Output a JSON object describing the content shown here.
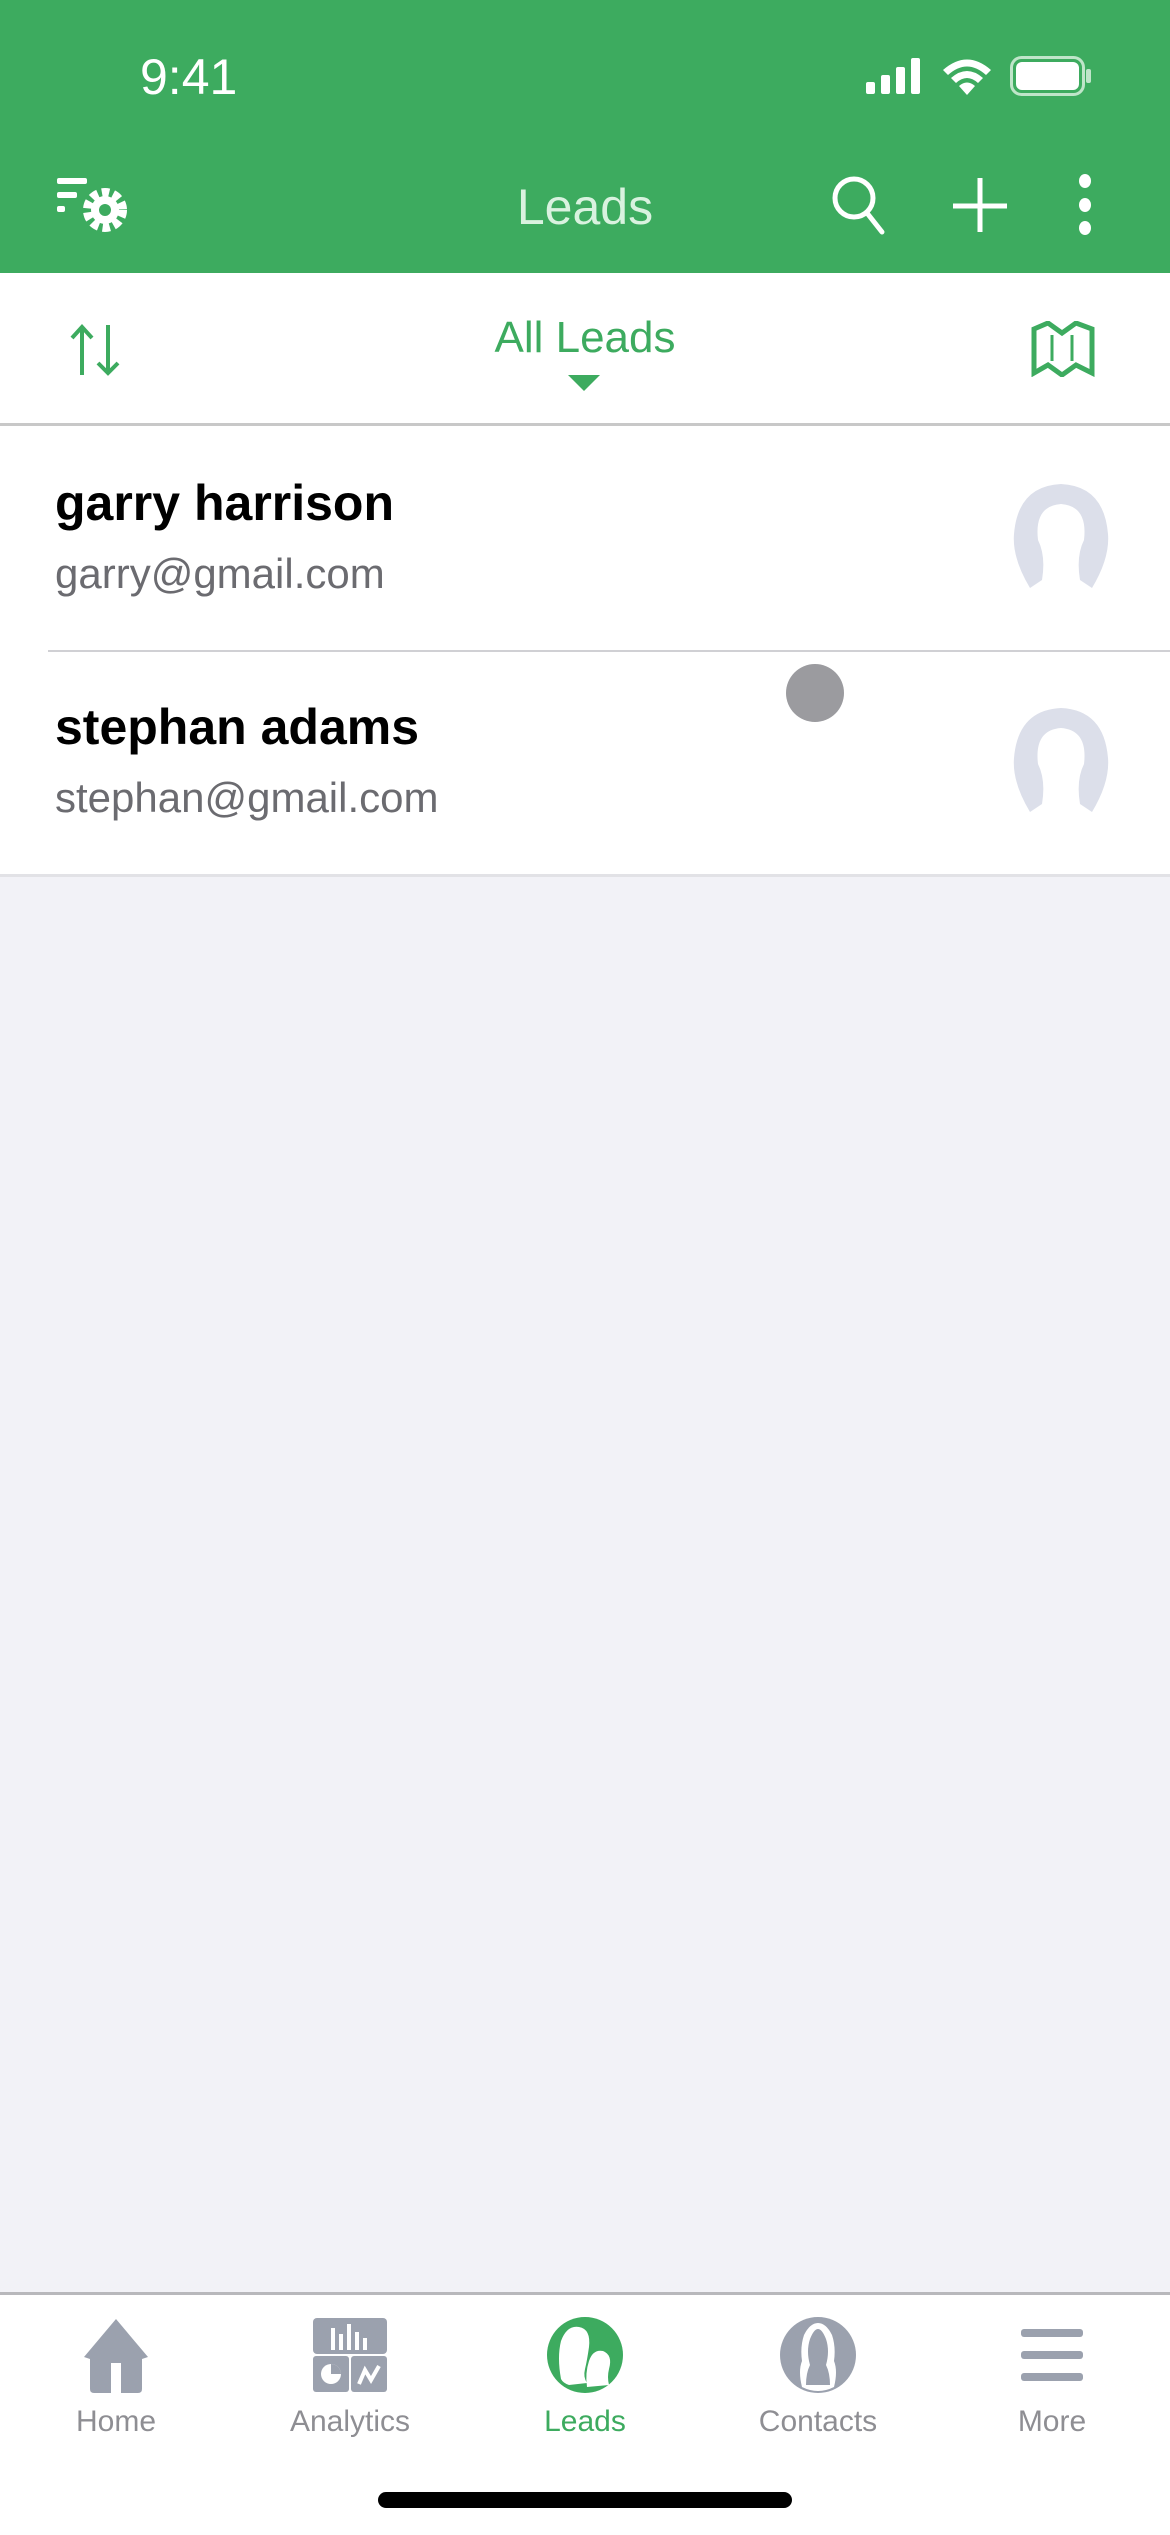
{
  "status_bar": {
    "time": "9:41"
  },
  "navbar": {
    "title": "Leads",
    "left_icon": "filter-settings-icon",
    "right_icons": [
      "search-icon",
      "plus-icon",
      "more-vertical-icon"
    ]
  },
  "filterbar": {
    "title": "All Leads",
    "left_icon": "sort-icon",
    "right_icon": "map-icon",
    "dropdown_icon": "caret-down-icon"
  },
  "leads": [
    {
      "name": "garry harrison",
      "email": "garry@gmail.com"
    },
    {
      "name": "stephan adams",
      "email": "stephan@gmail.com"
    }
  ],
  "tabbar": {
    "active": "Leads",
    "tabs": [
      {
        "label": "Home",
        "icon": "home-icon"
      },
      {
        "label": "Analytics",
        "icon": "analytics-icon"
      },
      {
        "label": "Leads",
        "icon": "leads-icon"
      },
      {
        "label": "Contacts",
        "icon": "contacts-icon"
      },
      {
        "label": "More",
        "icon": "menu-icon"
      }
    ]
  },
  "colors": {
    "brand": "#3dab5f",
    "inactive": "#8e8e93",
    "avatar": "#dcdfea"
  }
}
